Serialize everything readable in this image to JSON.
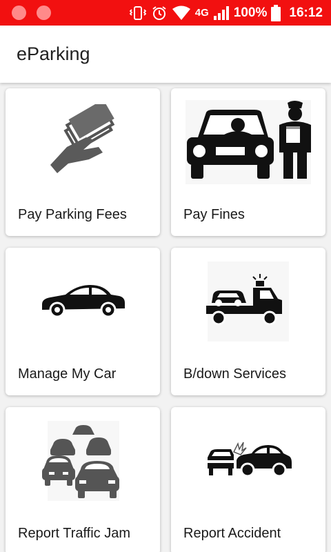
{
  "status_bar": {
    "network": "4G",
    "battery": "100%",
    "time": "16:12"
  },
  "app_bar": {
    "title": "eParking"
  },
  "tiles": [
    {
      "label": "Pay Parking Fees",
      "icon": "hand-holding-cash-icon"
    },
    {
      "label": "Pay Fines",
      "icon": "police-officer-car-icon"
    },
    {
      "label": "Manage My Car",
      "icon": "sedan-car-icon"
    },
    {
      "label": "B/down Services",
      "icon": "tow-truck-icon"
    },
    {
      "label": "Report Traffic Jam",
      "icon": "traffic-jam-icon"
    },
    {
      "label": "Report Accident",
      "icon": "car-collision-icon"
    }
  ],
  "colors": {
    "status_bar": "#f21010",
    "background": "#f2f2f2",
    "card": "#ffffff"
  }
}
